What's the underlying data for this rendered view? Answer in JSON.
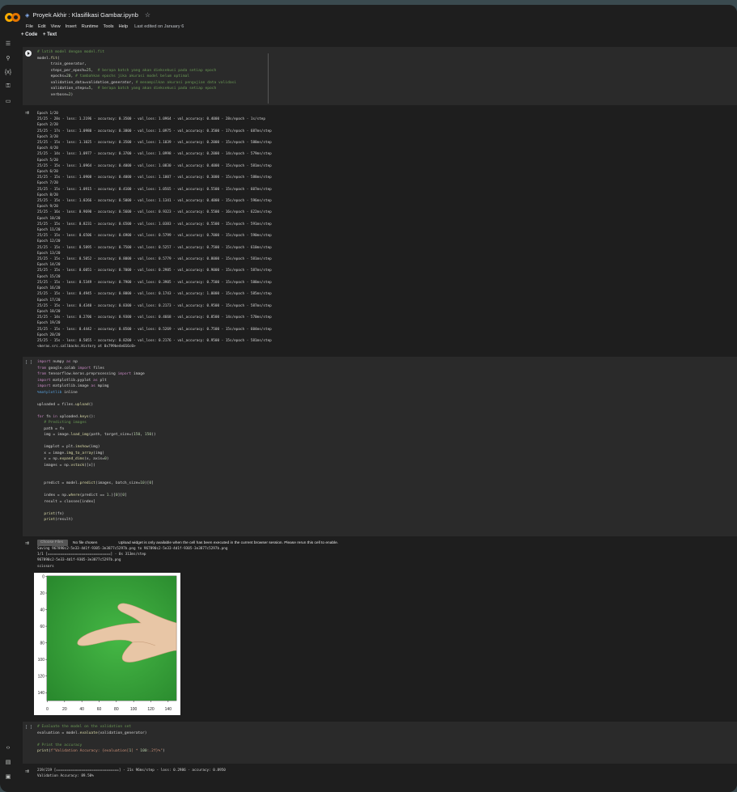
{
  "window": {
    "title": "Proyek Akhir : Klasifikasi Gambar.ipynb",
    "last_edited": "Last edited on January 6"
  },
  "menu": [
    "File",
    "Edit",
    "View",
    "Insert",
    "Runtime",
    "Tools",
    "Help"
  ],
  "toolbar": {
    "add_code": "+ Code",
    "add_text": "+ Text"
  },
  "cell1": {
    "lines": [
      "# latih model dengan model.fit",
      "model.fit(",
      "      train_generator,",
      "      steps_per_epoch=25,  # berapa batch yang akan dieksekusi pada setiap epoch",
      "      epochs=20, # tambahkan epochs jika akurasi model belum optimal",
      "      validation_data=validation_generator, # menampilkan akurasi pengujian data validasi",
      "      validation_steps=5,  # berapa batch yang akan dieksekusi pada setiap epoch",
      "      verbose=2)"
    ]
  },
  "output1": {
    "lines": [
      "Epoch 1/20",
      "25/25 - 28s - loss: 1.2196 - accuracy: 0.3500 - val_loss: 1.0964 - val_accuracy: 0.4000 - 28s/epoch - 1s/step",
      "Epoch 2/20",
      "25/25 - 17s - loss: 1.0980 - accuracy: 0.3800 - val_loss: 1.0975 - val_accuracy: 0.3500 - 17s/epoch - 687ms/step",
      "Epoch 3/20",
      "25/25 - 15s - loss: 1.1025 - accuracy: 0.3500 - val_loss: 1.1039 - val_accuracy: 0.2000 - 15s/epoch - 588ms/step",
      "Epoch 4/20",
      "25/25 - 14s - loss: 1.0977 - accuracy: 0.3700 - val_loss: 1.0998 - val_accuracy: 0.2000 - 14s/epoch - 579ms/step",
      "Epoch 5/20",
      "25/25 - 15s - loss: 1.0964 - accuracy: 0.4000 - val_loss: 1.0830 - val_accuracy: 0.4000 - 15s/epoch - 581ms/step",
      "Epoch 6/20",
      "25/25 - 15s - loss: 1.0908 - accuracy: 0.4000 - val_loss: 1.1007 - val_accuracy: 0.3000 - 15s/epoch - 588ms/step",
      "Epoch 7/20",
      "25/25 - 15s - loss: 1.0915 - accuracy: 0.4100 - val_loss: 1.0565 - val_accuracy: 0.5500 - 15s/epoch - 607ms/step",
      "Epoch 8/20",
      "25/25 - 15s - loss: 1.0266 - accuracy: 0.5000 - val_loss: 1.1341 - val_accuracy: 0.4000 - 15s/epoch - 596ms/step",
      "Epoch 9/20",
      "25/25 - 16s - loss: 0.9690 - accuracy: 0.5600 - val_loss: 0.9323 - val_accuracy: 0.5500 - 16s/epoch - 622ms/step",
      "Epoch 10/20",
      "25/25 - 15s - loss: 0.8231 - accuracy: 0.6500 - val_loss: 1.0383 - val_accuracy: 0.5500 - 15s/epoch - 591ms/step",
      "Epoch 11/20",
      "25/25 - 15s - loss: 0.6506 - accuracy: 0.6900 - val_loss: 0.5799 - val_accuracy: 0.7000 - 15s/epoch - 590ms/step",
      "Epoch 12/20",
      "25/25 - 15s - loss: 0.5895 - accuracy: 0.7500 - val_loss: 0.5257 - val_accuracy: 0.7500 - 15s/epoch - 610ms/step",
      "Epoch 13/20",
      "25/25 - 15s - loss: 0.5052 - accuracy: 0.8000 - val_loss: 0.5779 - val_accuracy: 0.8000 - 15s/epoch - 581ms/step",
      "Epoch 14/20",
      "25/25 - 15s - loss: 0.6051 - accuracy: 0.7000 - val_loss: 0.2985 - val_accuracy: 0.9000 - 15s/epoch - 587ms/step",
      "Epoch 15/20",
      "25/25 - 15s - loss: 0.5349 - accuracy: 0.7900 - val_loss: 0.3905 - val_accuracy: 0.7500 - 15s/epoch - 588ms/step",
      "Epoch 16/20",
      "25/25 - 15s - loss: 0.4945 - accuracy: 0.8000 - val_loss: 0.1743 - val_accuracy: 1.0000 - 15s/epoch - 585ms/step",
      "Epoch 17/20",
      "25/25 - 15s - loss: 0.4340 - accuracy: 0.8300 - val_loss: 0.2173 - val_accuracy: 0.9500 - 15s/epoch - 587ms/step",
      "Epoch 18/20",
      "25/25 - 14s - loss: 0.2706 - accuracy: 0.9300 - val_loss: 0.4668 - val_accuracy: 0.8500 - 14s/epoch - 570ms/step",
      "Epoch 19/20",
      "25/25 - 15s - loss: 0.4442 - accuracy: 0.8500 - val_loss: 0.5269 - val_accuracy: 0.7500 - 15s/epoch - 604ms/step",
      "Epoch 20/20",
      "25/25 - 15s - loss: 0.5055 - accuracy: 0.8200 - val_loss: 0.2176 - val_accuracy: 0.9500 - 15s/epoch - 581ms/step",
      "<keras.src.callbacks.History at 0x799be4e016c0>"
    ]
  },
  "cell2": {
    "bracket": "[ ]",
    "lines": [
      "import numpy as np",
      "from google.colab import files",
      "from tensorflow.keras.preprocessing import image",
      "import matplotlib.pyplot as plt",
      "import matplotlib.image as mpimg",
      "%matplotlib inline",
      "",
      "uploaded = files.upload()",
      "",
      "for fn in uploaded.keys():",
      "   # Predicting images",
      "   path = fn",
      "   img = image.load_img(path, target_size=(150, 150))",
      "",
      "   imgplot = plt.imshow(img)",
      "   x = image.img_to_array(img)",
      "   x = np.expand_dims(x, axis=0)",
      "   images = np.vstack([x])",
      "",
      "",
      "   predict = model.predict(images, batch_size=10)[0]",
      "",
      "   index = np.where(predict == 1.)[0][0]",
      "   result = classes[index]",
      "",
      "   print(fn)",
      "   print(result)"
    ]
  },
  "output2": {
    "choose_files": "Choose Files",
    "no_file": "No file chosen",
    "upload_note": "Upload widget is only available when the cell has been executed in the current browser session. Please rerun this cell to enable.",
    "lines": [
      "Saving 967890c2-5e33-4d1f-9305-3e3877c5297b.png to 967890c2-5e33-4d1f-9305-3e3877c5297b.png",
      "1/1 [==============================] - 0s 313ms/step",
      "967890c2-5e33-4d1f-9305-3e3877c5297b.png",
      "scissors"
    ],
    "yticks": [
      "0",
      "20",
      "40",
      "60",
      "80",
      "100",
      "120",
      "140"
    ],
    "xticks": [
      "0",
      "20",
      "40",
      "60",
      "80",
      "100",
      "120",
      "140"
    ]
  },
  "cell3": {
    "bracket": "[ ]",
    "lines": [
      "# Evaluate the model on the validation set",
      "evaluation = model.evaluate(validation_generator)",
      "",
      "# Print the accuracy",
      "print(f\"Validation Accuracy: {evaluation[1] * 100:.2f}%\")"
    ]
  },
  "output3": {
    "lines": [
      "219/219 [==============================] - 21s 96ms/step - loss: 0.2986 - accuracy: 0.8950",
      "Validation Accuracy: 89.50%"
    ]
  }
}
